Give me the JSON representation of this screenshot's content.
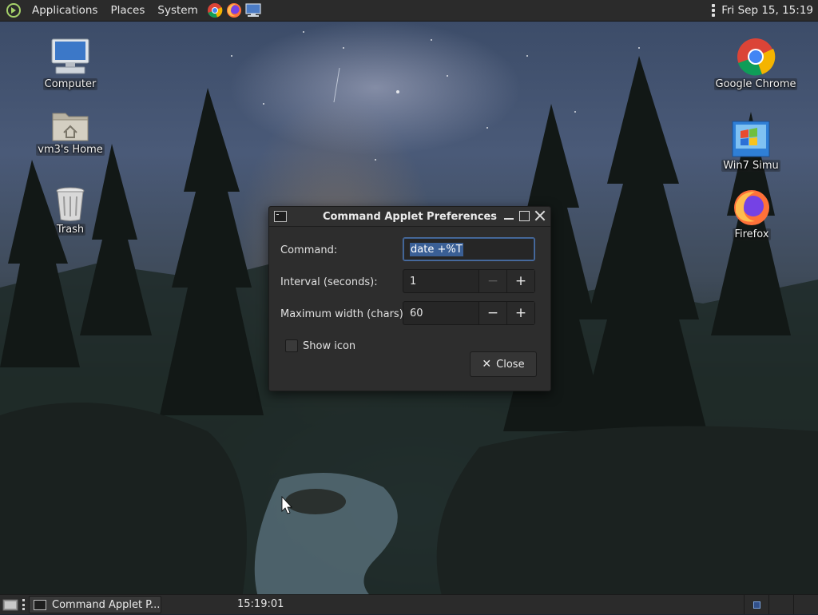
{
  "top_panel": {
    "menus": [
      "Applications",
      "Places",
      "System"
    ],
    "launchers": [
      "chrome-launcher",
      "firefox-launcher",
      "terminal-launcher"
    ],
    "clock": "Fri Sep 15, 15:19"
  },
  "desktop_icons": {
    "computer": "Computer",
    "home": "vm3's Home",
    "trash": "Trash",
    "chrome": "Google Chrome",
    "win7": "Win7 Simu",
    "firefox": "Firefox"
  },
  "dialog": {
    "title": "Command Applet Preferences",
    "command_label": "Command:",
    "command_value": "date +%T",
    "interval_label": "Interval (seconds):",
    "interval_value": "1",
    "max_width_label": "Maximum width (chars):",
    "max_width_value": "60",
    "show_icon_label": "Show icon",
    "show_icon_checked": false,
    "close_label": "Close",
    "minus_symbol": "−",
    "plus_symbol": "+",
    "close_symbol": "✕"
  },
  "bottom_panel": {
    "task_label": "Command Applet P...",
    "command_output": "15:19:01",
    "active_workspace": 1
  },
  "colors": {
    "panel_bg": "#2b2b2b",
    "dialog_bg": "#2d2d2d",
    "selection": "#3a5f95",
    "focus_border": "#4a6ea3"
  }
}
